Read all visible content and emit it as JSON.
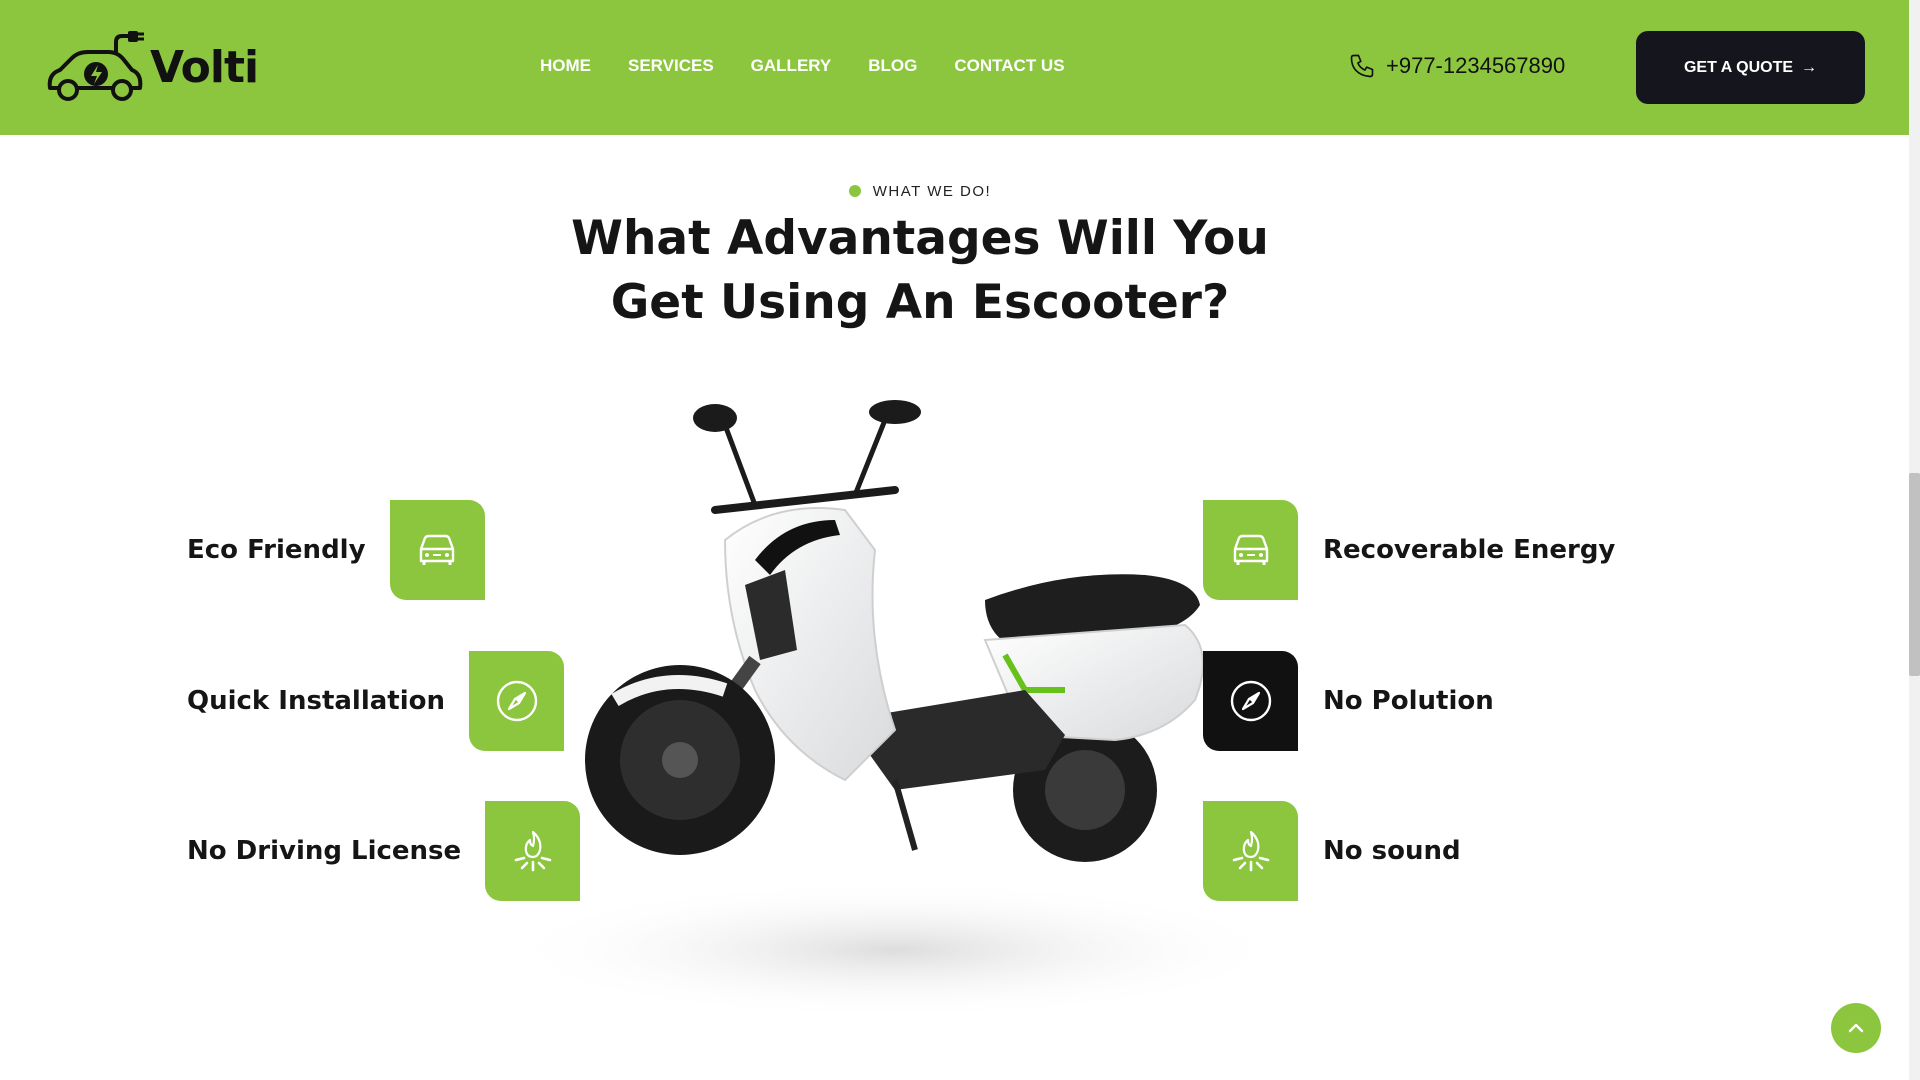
{
  "brand": {
    "name": "Volti",
    "logo_icon": "ev-car-plug-icon",
    "accent_color": "#8cc63f",
    "dark_color": "#15151d"
  },
  "nav": {
    "items": [
      {
        "label": "HOME"
      },
      {
        "label": "SERVICES"
      },
      {
        "label": "GALLERY"
      },
      {
        "label": "BLOG"
      },
      {
        "label": "CONTACT US"
      }
    ]
  },
  "header": {
    "phone": "+977-1234567890",
    "phone_icon": "phone-icon",
    "quote_label": "GET A QUOTE",
    "quote_icon": "arrow-right-icon"
  },
  "section": {
    "eyebrow": "WHAT WE DO!",
    "title_line1": "What Advantages Will You",
    "title_line2": "Get Using An Escooter?"
  },
  "features_left": [
    {
      "label": "Eco Friendly",
      "icon": "car-icon"
    },
    {
      "label": "Quick Installation",
      "icon": "compass-icon"
    },
    {
      "label": "No Driving License",
      "icon": "campfire-icon"
    }
  ],
  "features_right": [
    {
      "label": "Recoverable Energy",
      "icon": "car-icon"
    },
    {
      "label": "No Polution",
      "icon": "compass-icon"
    },
    {
      "label": "No sound",
      "icon": "campfire-icon"
    }
  ],
  "back_to_top_icon": "chevron-up-icon"
}
